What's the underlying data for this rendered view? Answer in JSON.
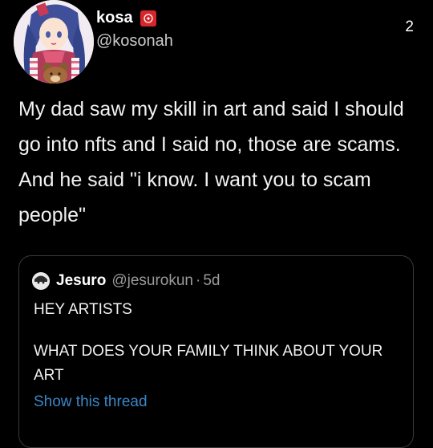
{
  "tweet": {
    "display_name": "kosa",
    "handle": "@kosonah",
    "count": "2",
    "text": "My dad saw my skill in art and said I should go into nfts and I said no, those are scams. And he said \"i know. I want you to scam people\""
  },
  "quoted_tweet": {
    "display_name": "Jesuro",
    "handle": "@jesurokun",
    "separator": "·",
    "time": "5d",
    "line1": "HEY ARTISTS",
    "line2": "WHAT DOES YOUR FAMILY THINK ABOUT YOUR ART",
    "show_thread": "Show this thread"
  },
  "colors": {
    "background": "#000000",
    "link": "#3b87c8",
    "badge": "#d6262b"
  },
  "icons": {
    "badge": "red-seal-icon"
  }
}
